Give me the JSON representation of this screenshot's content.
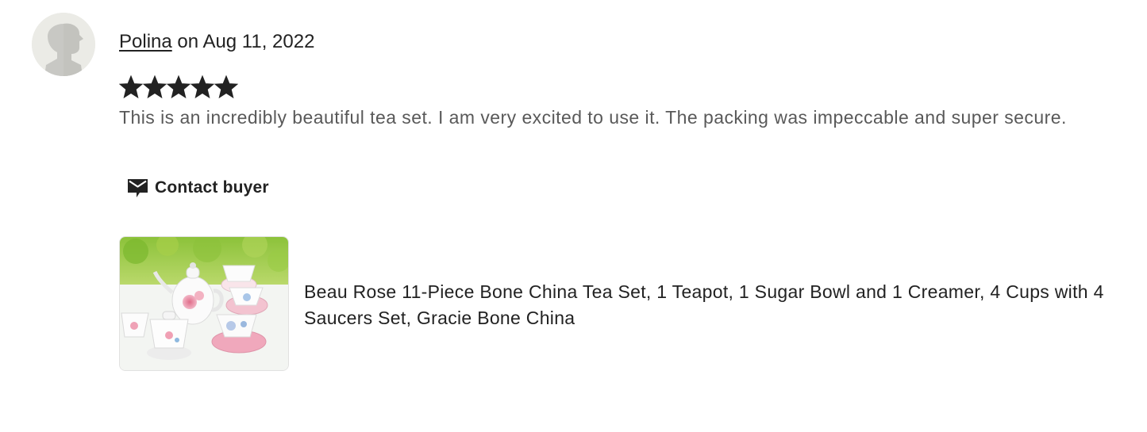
{
  "review": {
    "author": "Polina",
    "date_prefix": "on",
    "date": "Aug 11, 2022",
    "rating": 5,
    "rating_max": 5,
    "text": "This is an incredibly beautiful tea set. I am very excited to use it. The packing was impeccable and super secure.",
    "contact_label": "Contact buyer",
    "product_title": "Beau Rose 11-Piece Bone China Tea Set, 1 Teapot, 1 Sugar Bowl and 1 Creamer, 4 Cups with 4 Saucers Set, Gracie Bone China"
  },
  "icons": {
    "avatar": "default-user-silhouette-icon",
    "star": "star-filled-icon",
    "contact": "envelope-message-icon"
  },
  "colors": {
    "text_primary": "#222222",
    "text_secondary": "#595959",
    "avatar_bg": "#ebebe6",
    "star": "#222222"
  }
}
